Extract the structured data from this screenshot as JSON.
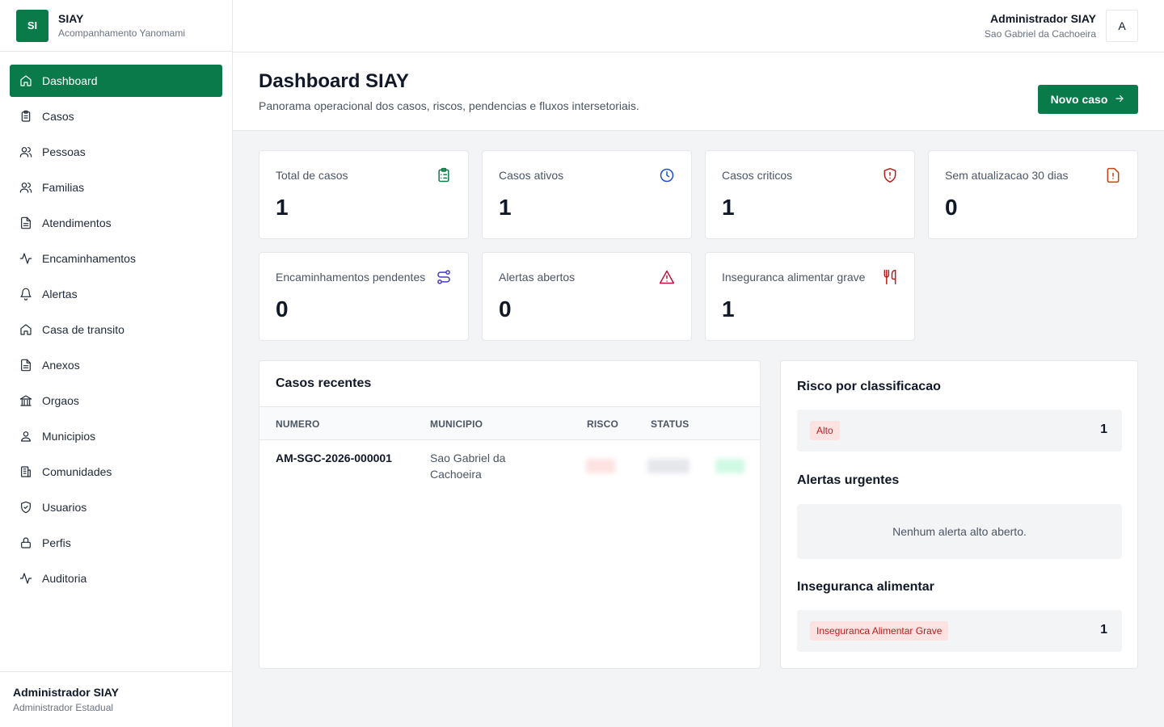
{
  "brand": {
    "logo": "SI",
    "name": "SIAY",
    "subtitle": "Acompanhamento Yanomami"
  },
  "nav": [
    {
      "label": "Dashboard",
      "icon": "home-icon",
      "active": true
    },
    {
      "label": "Casos",
      "icon": "clipboard-icon"
    },
    {
      "label": "Pessoas",
      "icon": "users-icon"
    },
    {
      "label": "Familias",
      "icon": "users-icon"
    },
    {
      "label": "Atendimentos",
      "icon": "file-text-icon"
    },
    {
      "label": "Encaminhamentos",
      "icon": "activity-icon"
    },
    {
      "label": "Alertas",
      "icon": "bell-icon"
    },
    {
      "label": "Casa de transito",
      "icon": "home-icon"
    },
    {
      "label": "Anexos",
      "icon": "file-text-icon"
    },
    {
      "label": "Orgaos",
      "icon": "landmark-icon"
    },
    {
      "label": "Municipios",
      "icon": "user-pin-icon"
    },
    {
      "label": "Comunidades",
      "icon": "building-icon"
    },
    {
      "label": "Usuarios",
      "icon": "shield-check-icon"
    },
    {
      "label": "Perfis",
      "icon": "lock-icon"
    },
    {
      "label": "Auditoria",
      "icon": "activity-icon"
    }
  ],
  "sidebar_footer": {
    "name": "Administrador SIAY",
    "role": "Administrador Estadual"
  },
  "topbar": {
    "user_name": "Administrador SIAY",
    "user_city": "Sao Gabriel da Cachoeira",
    "avatar": "A"
  },
  "page": {
    "title": "Dashboard SIAY",
    "subtitle": "Panorama operacional dos casos, riscos, pendencias e fluxos intersetoriais.",
    "new_button": "Novo caso"
  },
  "stats": [
    {
      "label": "Total de casos",
      "value": "1",
      "icon": "clipboard-list-icon",
      "color": "#0b7a4b"
    },
    {
      "label": "Casos ativos",
      "value": "1",
      "icon": "clock-icon",
      "color": "#1d4ed8"
    },
    {
      "label": "Casos criticos",
      "value": "1",
      "icon": "shield-alert-icon",
      "color": "#b91c1c"
    },
    {
      "label": "Sem atualizacao 30 dias",
      "value": "0",
      "icon": "file-warning-icon",
      "color": "#c2410c"
    },
    {
      "label": "Encaminhamentos pendentes",
      "value": "0",
      "icon": "route-icon",
      "color": "#4338ca"
    },
    {
      "label": "Alertas abertos",
      "value": "0",
      "icon": "alert-triangle-icon",
      "color": "#be123c"
    },
    {
      "label": "Inseguranca alimentar grave",
      "value": "1",
      "icon": "utensils-icon",
      "color": "#b91c1c"
    }
  ],
  "recent": {
    "title": "Casos recentes",
    "columns": [
      "NUMERO",
      "MUNICIPIO",
      "RISCO",
      "STATUS"
    ],
    "rows": [
      {
        "numero": "AM-SGC-2026-000001",
        "municipio": "Sao Gabriel da Cachoeira"
      }
    ]
  },
  "risk": {
    "title": "Risco por classificacao",
    "items": [
      {
        "label": "Alto",
        "count": "1"
      }
    ]
  },
  "urgent": {
    "title": "Alertas urgentes",
    "empty": "Nenhum alerta alto aberto."
  },
  "food": {
    "title": "Inseguranca alimentar",
    "items": [
      {
        "label": "Inseguranca Alimentar Grave",
        "count": "1"
      }
    ]
  }
}
